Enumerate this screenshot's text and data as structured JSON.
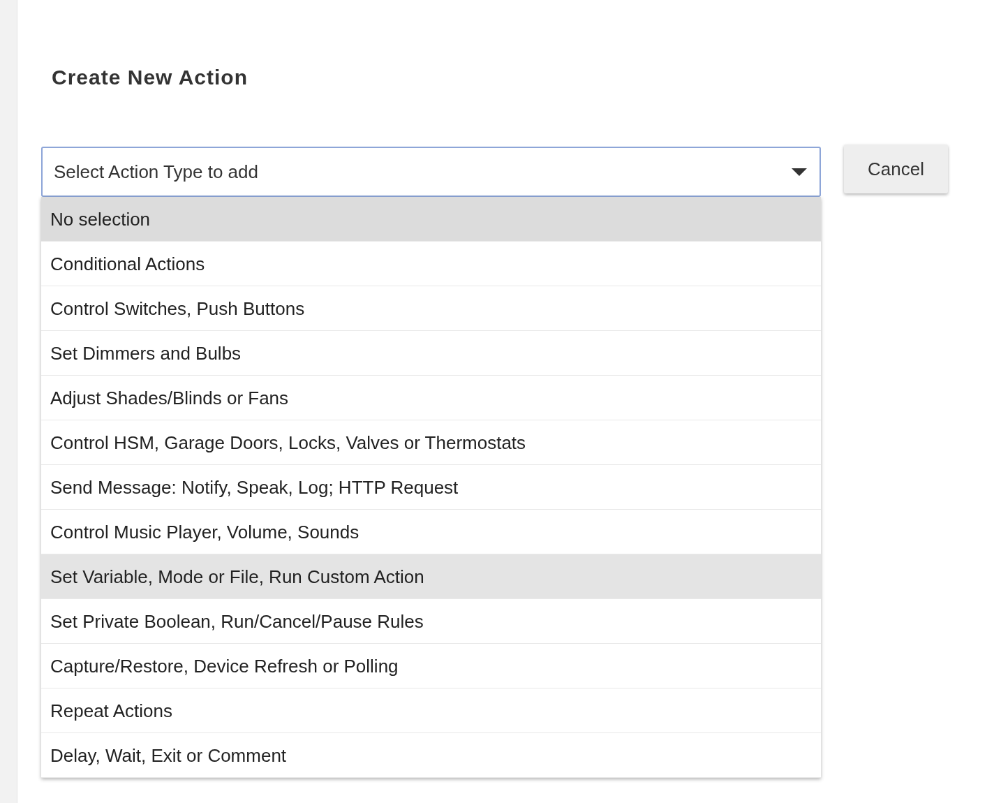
{
  "title": "Create New Action",
  "select": {
    "placeholder": "Select Action Type to add"
  },
  "cancel_button": "Cancel",
  "options": [
    {
      "label": "No selection",
      "selected": true,
      "hovered": false
    },
    {
      "label": "Conditional Actions",
      "selected": false,
      "hovered": false
    },
    {
      "label": "Control Switches, Push Buttons",
      "selected": false,
      "hovered": false
    },
    {
      "label": "Set Dimmers and Bulbs",
      "selected": false,
      "hovered": false
    },
    {
      "label": "Adjust Shades/Blinds or Fans",
      "selected": false,
      "hovered": false
    },
    {
      "label": "Control HSM, Garage Doors, Locks, Valves or Thermostats",
      "selected": false,
      "hovered": false
    },
    {
      "label": "Send Message: Notify, Speak, Log; HTTP Request",
      "selected": false,
      "hovered": false
    },
    {
      "label": "Control Music Player, Volume, Sounds",
      "selected": false,
      "hovered": false
    },
    {
      "label": "Set Variable, Mode or File, Run Custom Action",
      "selected": false,
      "hovered": true
    },
    {
      "label": "Set Private Boolean, Run/Cancel/Pause Rules",
      "selected": false,
      "hovered": false
    },
    {
      "label": "Capture/Restore, Device Refresh or Polling",
      "selected": false,
      "hovered": false
    },
    {
      "label": "Repeat Actions",
      "selected": false,
      "hovered": false
    },
    {
      "label": "Delay, Wait, Exit or Comment",
      "selected": false,
      "hovered": false
    }
  ]
}
